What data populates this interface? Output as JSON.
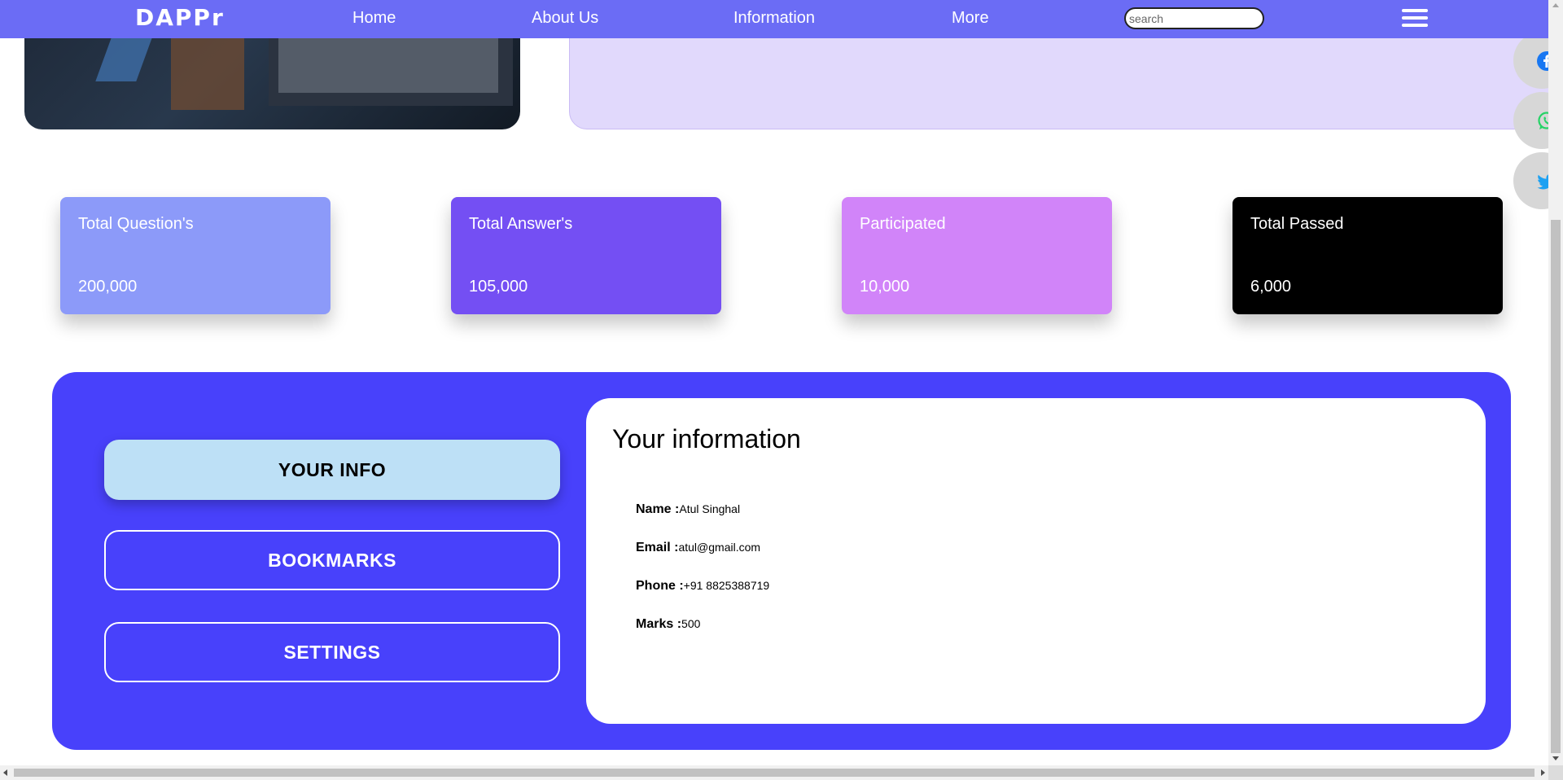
{
  "navbar": {
    "logo": "DAPPr",
    "links": {
      "home": "Home",
      "about": "About Us",
      "information": "Information",
      "more": "More"
    },
    "search_placeholder": "search"
  },
  "social": [
    "facebook-icon",
    "whatsapp-icon",
    "twitter-icon"
  ],
  "stats": [
    {
      "title": "Total Question's",
      "value": "200,000"
    },
    {
      "title": "Total Answer's",
      "value": "105,000"
    },
    {
      "title": "Participated",
      "value": "10,000"
    },
    {
      "title": "Total Passed",
      "value": "6,000"
    }
  ],
  "profile": {
    "menu": {
      "your_info": "YOUR INFO",
      "bookmarks": "BOOKMARKS",
      "settings": "SETTINGS"
    },
    "heading": "Your information",
    "fields": [
      {
        "label": "Name :",
        "value": "Atul Singhal"
      },
      {
        "label": "Email :",
        "value": "atul@gmail.com"
      },
      {
        "label": "Phone :",
        "value": "+91 8825388719"
      },
      {
        "label": "Marks :",
        "value": "500"
      }
    ]
  },
  "colors": {
    "navbar": "#6b6cf5",
    "profile_panel": "#4841fb",
    "active_menu": "#bde0f6",
    "stat_1": "#8c9af9",
    "stat_2": "#744ff3",
    "stat_3": "#d184f9",
    "stat_4": "#000000"
  }
}
